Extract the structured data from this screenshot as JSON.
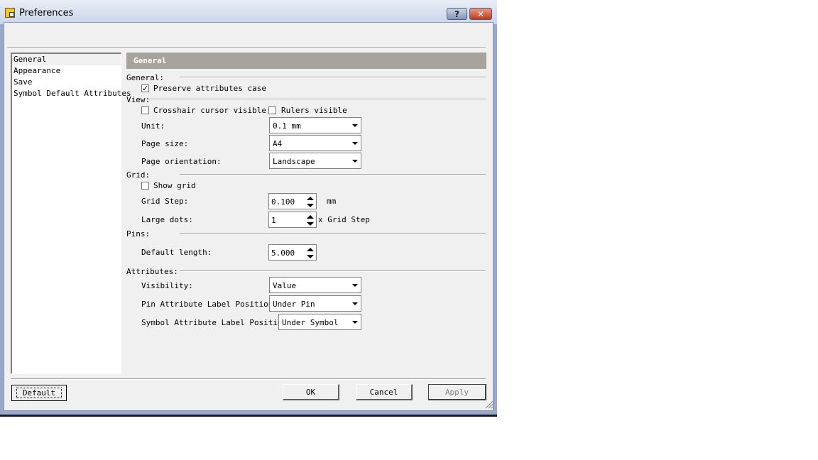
{
  "window": {
    "title": "Preferences",
    "help_label": "?",
    "close_label": "✕"
  },
  "nav": {
    "items": [
      {
        "label": "General",
        "selected": true
      },
      {
        "label": "Appearance",
        "selected": false
      },
      {
        "label": "Save",
        "selected": false
      },
      {
        "label": "Symbol Default Attributes",
        "selected": false
      }
    ]
  },
  "panel": {
    "header": "General",
    "general": {
      "section": "General:",
      "preserve_case": {
        "label": "Preserve attributes case",
        "checked": true
      }
    },
    "view": {
      "section": "View:",
      "crosshair": {
        "label": "Crosshair cursor visible",
        "checked": false
      },
      "rulers": {
        "label": "Rulers visible",
        "checked": false
      },
      "unit_label": "Unit:",
      "unit_value": "0.1 mm",
      "page_size_label": "Page size:",
      "page_size_value": "A4",
      "orientation_label": "Page orientation:",
      "orientation_value": "Landscape"
    },
    "grid": {
      "section": "Grid:",
      "show_grid": {
        "label": "Show grid",
        "checked": false
      },
      "step_label": "Grid Step:",
      "step_value": "0.100",
      "step_unit": "mm",
      "dots_label": "Large dots:",
      "dots_value": "1",
      "dots_suffix": "x Grid Step"
    },
    "pins": {
      "section": "Pins:",
      "length_label": "Default length:",
      "length_value": "5.000"
    },
    "attributes": {
      "section": "Attributes:",
      "visibility_label": "Visibility:",
      "visibility_value": "Value",
      "pin_pos_label": "Pin Attribute Label Position:",
      "pin_pos_value": "Under Pin",
      "sym_pos_label": "Symbol Attribute Label Position:",
      "sym_pos_value": "Under Symbol"
    }
  },
  "buttons": {
    "default": "Default",
    "ok": "OK",
    "cancel": "Cancel",
    "apply": "Apply"
  }
}
